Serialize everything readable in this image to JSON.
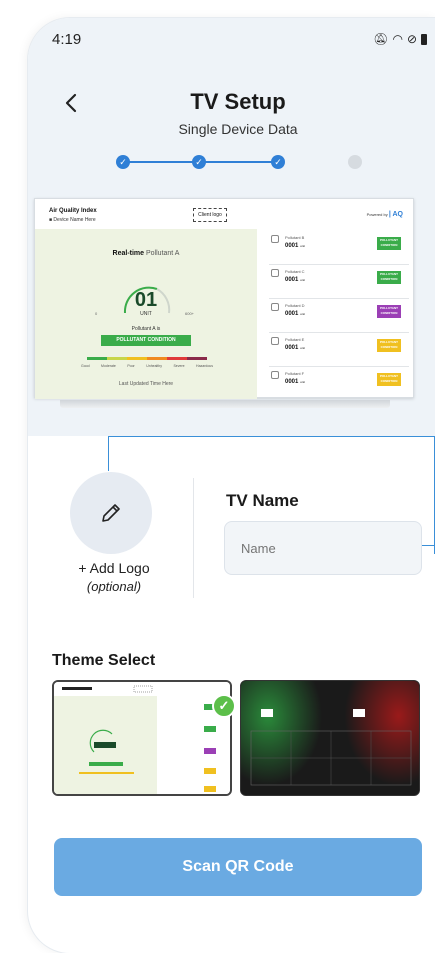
{
  "status": {
    "time": "4:19"
  },
  "header": {
    "title": "TV Setup",
    "subtitle": "Single Device Data",
    "back_icon": "chevron-left-icon"
  },
  "stepper": {
    "total": 4,
    "completed": 3
  },
  "preview": {
    "title": "Air Quality Index",
    "device": "Device Name Here",
    "client_logo": "Client logo",
    "powered_by": "Powered by",
    "realtime_label": "Real-time",
    "realtime_pollutant": "Pollutant A",
    "value": "01",
    "unit": "UNIT",
    "min": "0",
    "max": "600+",
    "is_label": "Pollutant A is",
    "condition": "POLLUTANT CONDITION",
    "scale_labels": [
      "Good",
      "Moderate",
      "Poor",
      "Unhealthy",
      "Severe",
      "Hazardous"
    ],
    "updated": "Last Updated Time Here",
    "pollutants": [
      {
        "name": "Pollutant B",
        "value": "0001",
        "unit": "unit",
        "badge": "POLLUTANT CONDITION",
        "color": "#3aac4a"
      },
      {
        "name": "Pollutant C",
        "value": "0001",
        "unit": "unit",
        "badge": "POLLUTANT CONDITION",
        "color": "#3aac4a"
      },
      {
        "name": "Pollutant D",
        "value": "0001",
        "unit": "unit",
        "badge": "POLLUTANT CONDITION",
        "color": "#9b3fb5"
      },
      {
        "name": "Pollutant E",
        "value": "0001",
        "unit": "unit",
        "badge": "POLLUTANT CONDITION",
        "color": "#f0c020"
      },
      {
        "name": "Pollutant F",
        "value": "0001",
        "unit": "unit",
        "badge": "POLLUTANT CONDITION",
        "color": "#f0c020"
      }
    ]
  },
  "logo": {
    "add_label": "+ Add Logo",
    "optional_label": "(optional)"
  },
  "tv_name": {
    "label": "TV Name",
    "placeholder": "Name",
    "value": ""
  },
  "theme": {
    "label": "Theme Select",
    "selected": 0
  },
  "scan_button": {
    "label": "Scan QR Code"
  },
  "colors": {
    "accent": "#2f7fd6",
    "button": "#6aaae2",
    "check": "#5cbf4a"
  }
}
